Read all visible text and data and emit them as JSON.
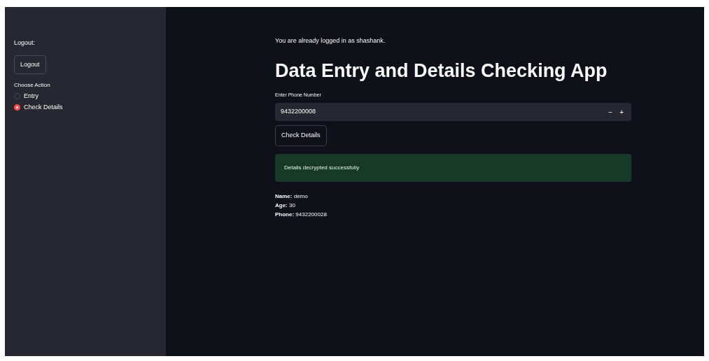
{
  "sidebar": {
    "logout_label": "Logout:",
    "logout_button": "Logout",
    "radio_label": "Choose Action",
    "options": [
      {
        "label": "Entry",
        "selected": false
      },
      {
        "label": "Check Details",
        "selected": true
      }
    ]
  },
  "main": {
    "status": "You are already logged in as shashank.",
    "title": "Data Entry and Details Checking App",
    "field": {
      "label": "Enter Phone Number",
      "value": "9432200008",
      "minus": "−",
      "plus": "+"
    },
    "button": "Check Details",
    "alert": "Details decrypted successfully",
    "details": [
      "**Name:** demo",
      "**Age:** 30",
      "**Phone:** 9432200028"
    ]
  }
}
